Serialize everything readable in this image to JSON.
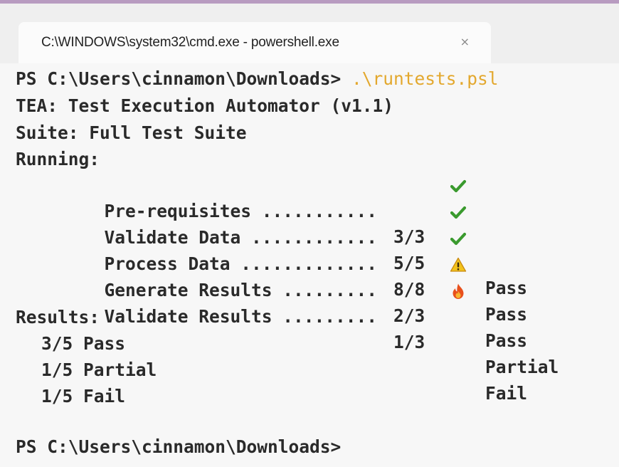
{
  "window": {
    "tab_title": "C:\\WINDOWS\\system32\\cmd.exe - powershell.exe",
    "tab_close": "×"
  },
  "console": {
    "prompt1": "PS C:\\Users\\cinnamon\\Downloads>",
    "command": " .\\runtests.psl",
    "header": "TEA: Test Execution Automator (v1.1)",
    "suite": "Suite: Full Test Suite",
    "running_label": "Running:",
    "tests": [
      {
        "name": "Pre-requisites ...........",
        "count": "3/3",
        "icon": "check-icon",
        "status": "Pass"
      },
      {
        "name": "Validate Data ............",
        "count": "5/5",
        "icon": "check-icon",
        "status": "Pass"
      },
      {
        "name": "Process Data .............",
        "count": "8/8",
        "icon": "check-icon",
        "status": "Pass"
      },
      {
        "name": "Generate Results .........",
        "count": "2/3",
        "icon": "warning-icon",
        "status": "Partial"
      },
      {
        "name": "Validate Results .........",
        "count": "1/3",
        "icon": "fire-icon",
        "status": "Fail"
      }
    ],
    "results_label": "Results:",
    "results": [
      "3/5 Pass",
      "1/5 Partial",
      "1/5 Fail"
    ],
    "prompt2": "PS C:\\Users\\cinnamon\\Downloads>"
  },
  "colors": {
    "command": "#e3a82e",
    "check": "#3a9a2e",
    "warning": "#f2c21b",
    "fire": "#e8501c",
    "text": "#2a2a2a"
  }
}
